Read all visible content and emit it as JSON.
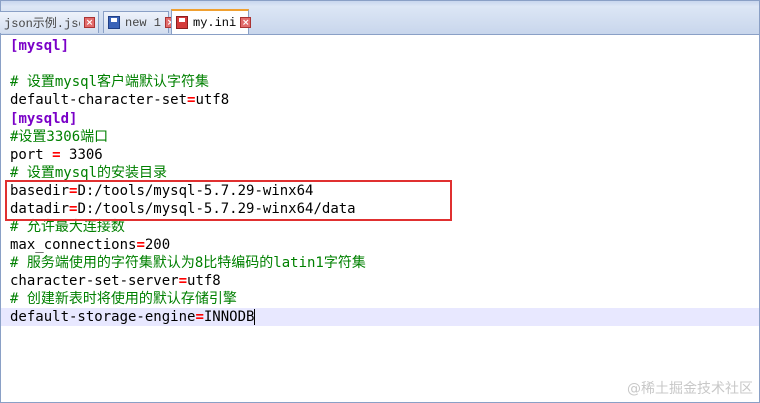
{
  "tabs": [
    {
      "label": "json示例.json",
      "state": "saved",
      "active": false
    },
    {
      "label": "new 1",
      "state": "saved",
      "active": false
    },
    {
      "label": "my.ini",
      "state": "changed",
      "active": true
    }
  ],
  "editor": {
    "lines": [
      {
        "type": "section",
        "name": "mysql"
      },
      {
        "type": "blank"
      },
      {
        "type": "comment",
        "text": "# 设置mysql客户端默认字符集"
      },
      {
        "type": "kv",
        "key": "default-character-set",
        "value": "utf8"
      },
      {
        "type": "section",
        "name": "mysqld"
      },
      {
        "type": "comment",
        "text": "#设置3306端口"
      },
      {
        "type": "kv",
        "key": "port ",
        "value": " 3306"
      },
      {
        "type": "comment",
        "text": "# 设置mysql的安装目录"
      },
      {
        "type": "kv",
        "key": "basedir",
        "value": "D:/tools/mysql-5.7.29-winx64"
      },
      {
        "type": "kv",
        "key": "datadir",
        "value": "D:/tools/mysql-5.7.29-winx64/data"
      },
      {
        "type": "comment",
        "text": "# 允许最大连接数"
      },
      {
        "type": "kv",
        "key": "max_connections",
        "value": "200"
      },
      {
        "type": "comment",
        "text": "# 服务端使用的字符集默认为8比特编码的latin1字符集"
      },
      {
        "type": "kv",
        "key": "character-set-server",
        "value": "utf8"
      },
      {
        "type": "comment",
        "text": "# 创建新表时将使用的默认存储引擎"
      },
      {
        "type": "kv",
        "key": "default-storage-engine",
        "value": "INNODB",
        "current": true
      }
    ]
  },
  "watermark": "@稀土掘金技术社区"
}
